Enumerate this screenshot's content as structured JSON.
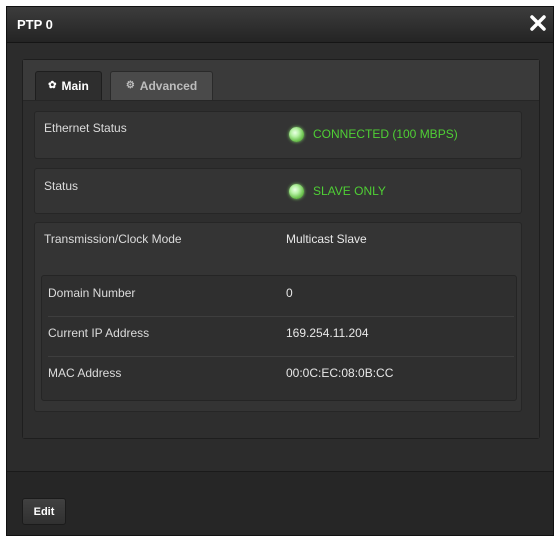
{
  "dialog": {
    "title": "PTP 0",
    "close_icon": "close-icon"
  },
  "tabs": [
    {
      "label": "Main",
      "icon": "gear-icon",
      "active": true
    },
    {
      "label": "Advanced",
      "icon": "gears-icon",
      "active": false
    }
  ],
  "ethernet_status": {
    "label": "Ethernet Status",
    "value": "CONNECTED (100 MBPS)",
    "indicator_color": "#6cc24f"
  },
  "status": {
    "label": "Status",
    "value": "SLAVE ONLY",
    "indicator_color": "#6cc24f"
  },
  "transmission": {
    "label": "Transmission/Clock Mode",
    "value": "Multicast Slave"
  },
  "details": [
    {
      "label": "Domain Number",
      "value": "0"
    },
    {
      "label": "Current IP Address",
      "value": "169.254.11.204"
    },
    {
      "label": "MAC Address",
      "value": "00:0C:EC:08:0B:CC"
    }
  ],
  "footer": {
    "edit_label": "Edit"
  },
  "colors": {
    "status_green": "#4fcf35",
    "background": "#2e2e2e"
  }
}
